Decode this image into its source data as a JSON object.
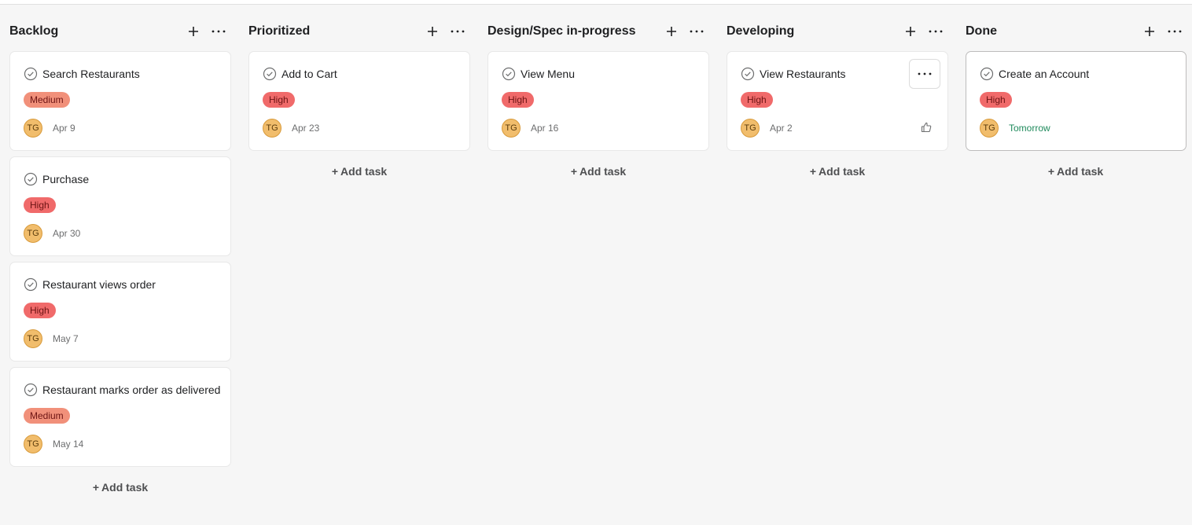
{
  "colors": {
    "background": "#f6f6f6",
    "card": "#ffffff",
    "priority_medium": "#f1907a",
    "priority_high": "#f06a6a",
    "avatar": "#f1bd6c",
    "due_soon": "#1f8a5c"
  },
  "icons": {
    "add": "plus-icon",
    "more": "more-horizontal-icon",
    "check": "check-circle-icon",
    "like": "thumbs-up-icon"
  },
  "columns": [
    {
      "title": "Backlog",
      "add_task_label": "Add task",
      "cards": [
        {
          "title": "Search Restaurants",
          "priority": "Medium",
          "assignee": "TG",
          "due": "Apr 9"
        },
        {
          "title": "Purchase",
          "priority": "High",
          "assignee": "TG",
          "due": "Apr 30"
        },
        {
          "title": "Restaurant views order",
          "priority": "High",
          "assignee": "TG",
          "due": "May 7"
        },
        {
          "title": "Restaurant marks order as delivered",
          "priority": "Medium",
          "assignee": "TG",
          "due": "May 14"
        }
      ]
    },
    {
      "title": "Prioritized",
      "add_task_label": "Add task",
      "cards": [
        {
          "title": "Add to Cart",
          "priority": "High",
          "assignee": "TG",
          "due": "Apr 23"
        }
      ]
    },
    {
      "title": "Design/Spec in-progress",
      "add_task_label": "Add task",
      "cards": [
        {
          "title": "View Menu",
          "priority": "High",
          "assignee": "TG",
          "due": "Apr 16"
        }
      ]
    },
    {
      "title": "Developing",
      "add_task_label": "Add task",
      "cards": [
        {
          "title": "View Restaurants",
          "priority": "High",
          "assignee": "TG",
          "due": "Apr 2",
          "hovered": true
        }
      ]
    },
    {
      "title": "Done",
      "add_task_label": "Add task",
      "cards": [
        {
          "title": "Create an Account",
          "priority": "High",
          "assignee": "TG",
          "due": "Tomorrow",
          "due_soon": true,
          "selected": true
        }
      ]
    }
  ]
}
